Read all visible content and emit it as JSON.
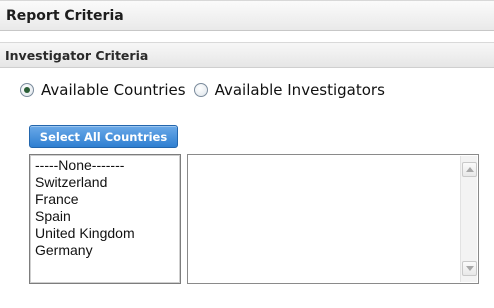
{
  "report": {
    "title": "Report Criteria"
  },
  "investigator_section": {
    "title": "Investigator Criteria",
    "options": [
      {
        "label": "Available Countries",
        "selected": true
      },
      {
        "label": "Available Investigators",
        "selected": false
      }
    ]
  },
  "select_all_button": {
    "label": "Select All Countries",
    "color": "#3a86d6"
  },
  "countries": {
    "items": [
      "-----None-------",
      "Switzerland",
      "France",
      "Spain",
      "United Kingdom",
      "Germany"
    ]
  },
  "investigators": {
    "items": []
  },
  "icons": {
    "scroll_up": "chevron-up-icon",
    "scroll_down": "chevron-down-icon"
  }
}
